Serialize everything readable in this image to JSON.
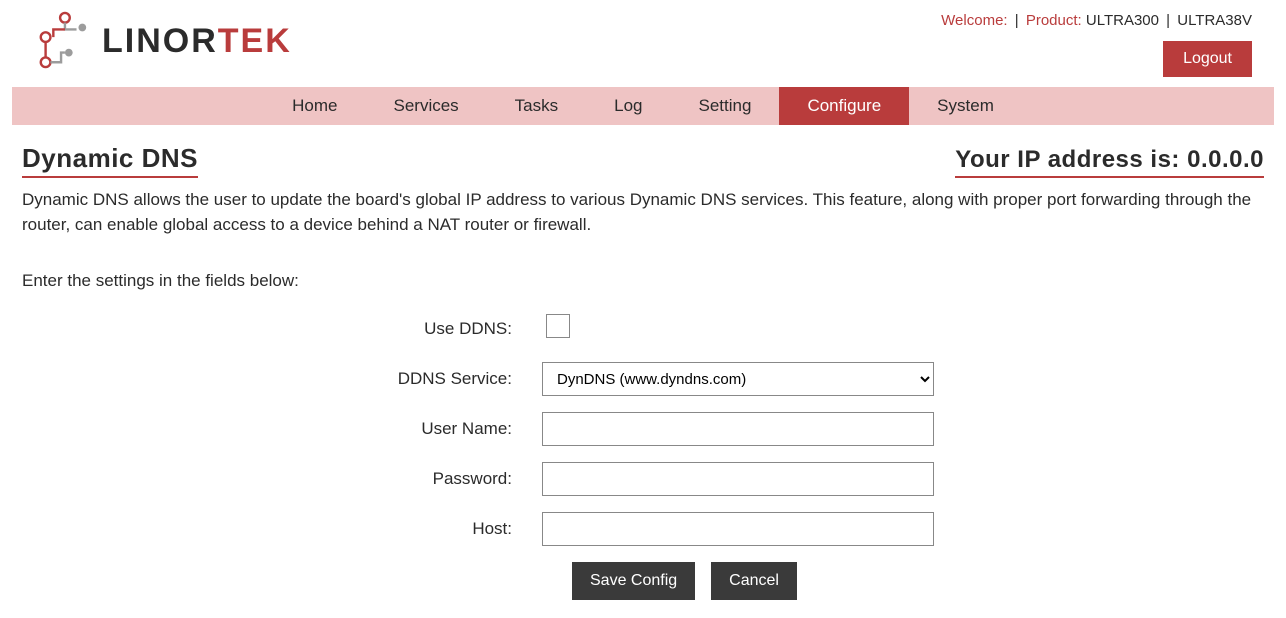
{
  "logo": {
    "text_dark": "LINOR",
    "text_red": "TEK"
  },
  "header": {
    "welcome_label": "Welcome:",
    "welcome_value": "",
    "product_label": "Product:",
    "product_value": "ULTRA300",
    "product_value2": "ULTRA38V",
    "logout": "Logout"
  },
  "nav": {
    "items": [
      {
        "label": "Home",
        "active": false
      },
      {
        "label": "Services",
        "active": false
      },
      {
        "label": "Tasks",
        "active": false
      },
      {
        "label": "Log",
        "active": false
      },
      {
        "label": "Setting",
        "active": false
      },
      {
        "label": "Configure",
        "active": true
      },
      {
        "label": "System",
        "active": false
      }
    ]
  },
  "page": {
    "title": "Dynamic DNS",
    "ip_label": "Your IP address is: ",
    "ip_value": "0.0.0.0",
    "description": "Dynamic DNS allows the user to update the board's global IP address to various Dynamic DNS services. This feature, along with proper port forwarding through the router, can enable global access to a device behind a NAT router or firewall.",
    "prompt": "Enter the settings in the fields below:"
  },
  "form": {
    "use_ddns_label": "Use DDNS:",
    "use_ddns_checked": false,
    "service_label": "DDNS Service:",
    "service_value": "DynDNS (www.dyndns.com)",
    "username_label": "User Name:",
    "username_value": "",
    "password_label": "Password:",
    "password_value": "",
    "host_label": "Host:",
    "host_value": "",
    "save_label": "Save Config",
    "cancel_label": "Cancel"
  }
}
